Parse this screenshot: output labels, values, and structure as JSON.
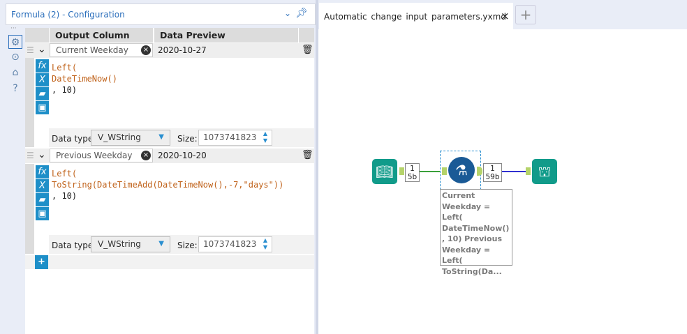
{
  "config": {
    "title": "Formula (2) - Configuration"
  },
  "grid": {
    "col_output": "Output Column",
    "col_preview": "Data Preview",
    "data_type_label": "Data type:",
    "size_label": "Size:",
    "rows": [
      {
        "name": "Current Weekday",
        "preview": "2020-10-27",
        "expr": [
          "Left(",
          "DateTimeNow()",
          ", 10)"
        ],
        "type": "V_WString",
        "size": "1073741823"
      },
      {
        "name": "Previous Weekday",
        "preview": "2020-10-20",
        "expr": [
          "Left(",
          "ToString(DateTimeAdd(DateTimeNow(),-7,\"days\"))",
          ", 10)"
        ],
        "type": "V_WString",
        "size": "1073741823"
      }
    ]
  },
  "tab": {
    "title": "Automatic change input parameters.yxmd",
    "close": "×",
    "add": "+"
  },
  "workflow": {
    "in_count": "1",
    "in_size": "5b",
    "out_count": "1",
    "out_size": "59b",
    "annotation": "Current Weekday = Left( DateTimeNow() , 10) Previous Weekday = Left( ToString(Da..."
  }
}
